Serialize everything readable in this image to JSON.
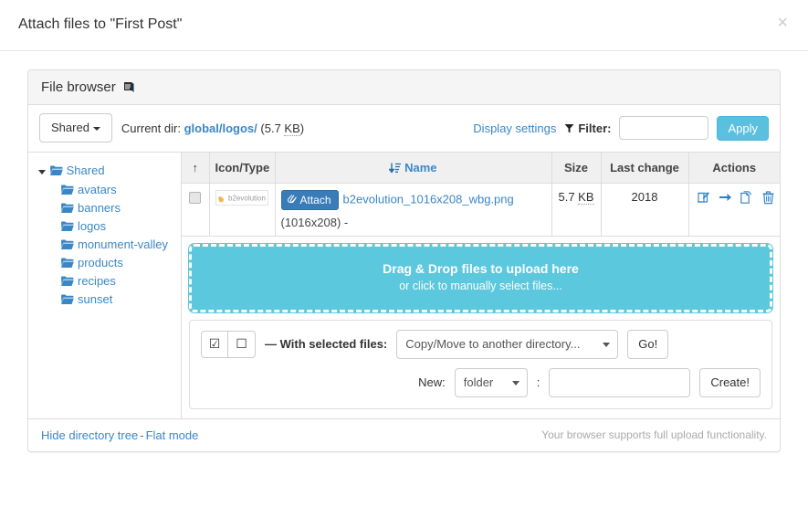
{
  "modal": {
    "title": "Attach files to \"First Post\"",
    "close_label": "×"
  },
  "panel": {
    "title": "File browser",
    "help_icon": "book-icon"
  },
  "toolbar": {
    "root_selector_label": "Shared",
    "current_dir_label": "Current dir:",
    "path_part1": "global",
    "path_sep1": "/",
    "path_part2": "logos",
    "path_sep2": "/",
    "dir_size": "(5.7 ",
    "dir_size_unit": "KB",
    "dir_size_close": ")",
    "display_settings_label": "Display settings",
    "filter_label": "Filter:",
    "filter_value": "",
    "apply_label": "Apply"
  },
  "tree": {
    "root": {
      "label": "Shared",
      "expanded": true
    },
    "items": [
      {
        "label": "avatars"
      },
      {
        "label": "banners"
      },
      {
        "label": "logos"
      },
      {
        "label": "monument-valley"
      },
      {
        "label": "products"
      },
      {
        "label": "recipes"
      },
      {
        "label": "sunset"
      }
    ]
  },
  "table": {
    "headers": {
      "order": "↑",
      "icon_type": "Icon/Type",
      "name": "Name",
      "size": "Size",
      "last_change": "Last change",
      "actions": "Actions"
    },
    "rows": [
      {
        "thumb_text": "b2evolution",
        "attach_label": "Attach",
        "file_name": "b2evolution_1016x208_wbg.png",
        "dimensions": "(1016x208) -",
        "size": "5.7 ",
        "size_unit": "KB",
        "last_change": "2018",
        "actions": [
          "edit-icon",
          "move-icon",
          "copy-icon",
          "delete-icon"
        ]
      }
    ]
  },
  "dropzone": {
    "main_text": "Drag & Drop files to upload here",
    "sub_text": "or click to manually select files..."
  },
  "bulk": {
    "check_all_label": "☑",
    "uncheck_all_label": "☐",
    "with_selected_label": "— With selected files:",
    "action_selected": "Copy/Move to another directory...",
    "action_options": [
      "Copy/Move to another directory..."
    ],
    "go_label": "Go!",
    "new_label": "New:",
    "new_type_selected": "folder",
    "new_type_options": [
      "folder"
    ],
    "new_separator": ":",
    "new_name_value": "",
    "create_label": "Create!"
  },
  "footer": {
    "hide_tree_label": "Hide directory tree",
    "separator": "-",
    "flat_mode_label": "Flat mode",
    "upload_note": "Your browser supports full upload functionality."
  },
  "colors": {
    "link": "#3a87c8",
    "info": "#5bc0de",
    "dropzone": "#5bc8dd",
    "attach_btn": "#3a7cb8",
    "border": "#dddddd",
    "panel_head": "#f5f5f5"
  }
}
